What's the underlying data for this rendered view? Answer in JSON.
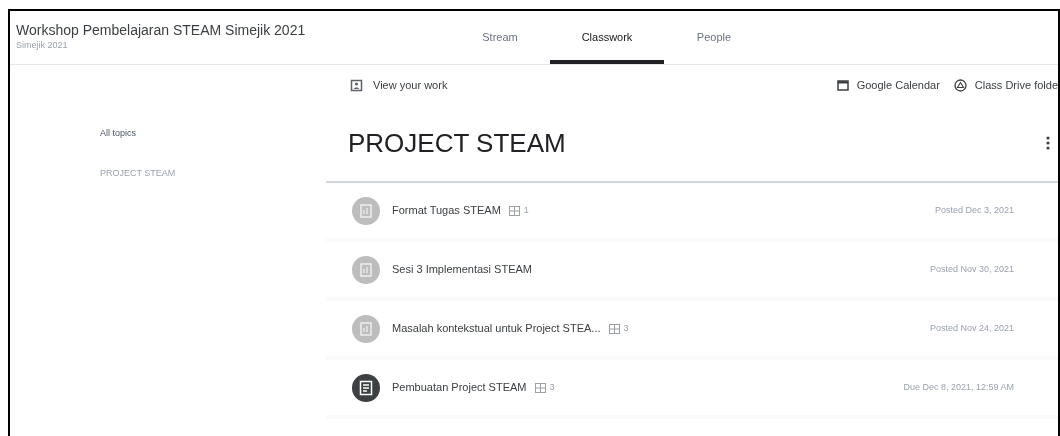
{
  "header": {
    "title": "Workshop Pembelajaran STEAM Simejik 2021",
    "subtitle": "Simejik 2021"
  },
  "tabs": [
    {
      "label": "Stream",
      "selected": false
    },
    {
      "label": "Classwork",
      "selected": true
    },
    {
      "label": "People",
      "selected": false
    }
  ],
  "toolbar": {
    "view_work": "View your work",
    "calendar": "Google Calendar",
    "drive": "Class Drive folde"
  },
  "topics": [
    {
      "label": "All topics",
      "selected": true
    },
    {
      "label": "PROJECT STEAM",
      "selected": false
    }
  ],
  "section": {
    "title": "PROJECT STEAM"
  },
  "items": [
    {
      "kind": "material",
      "title": "Format Tugas STEAM",
      "attachments": "1",
      "date": "Posted Dec 3, 2021"
    },
    {
      "kind": "material",
      "title": "Sesi 3 Implementasi STEAM",
      "date": "Posted Nov 30, 2021"
    },
    {
      "kind": "material",
      "title": "Masalah kontekstual untuk Project STEA...",
      "attachments": "3",
      "date": "Posted Nov 24, 2021"
    },
    {
      "kind": "assignment",
      "title": "Pembuatan Project STEAM",
      "attachments": "3",
      "date": "Due Dec 8, 2021, 12:59 AM"
    }
  ]
}
